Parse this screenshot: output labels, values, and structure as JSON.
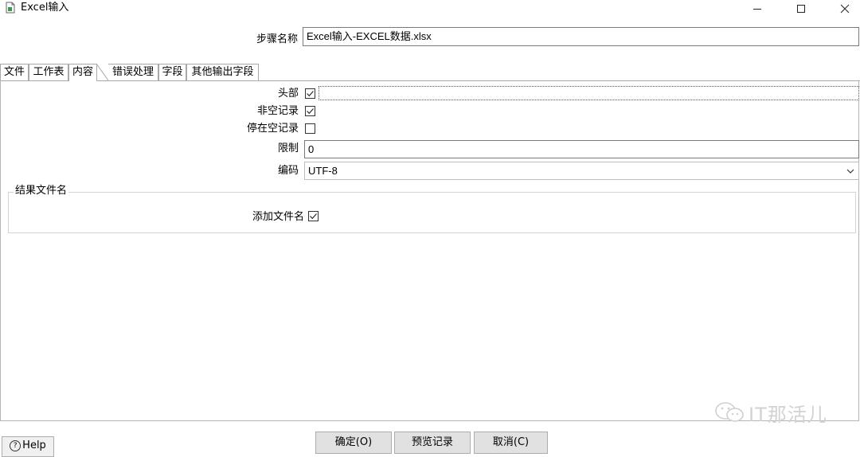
{
  "window": {
    "title": "Excel输入",
    "controls": {
      "minimize": "minimize-icon",
      "maximize": "maximize-icon",
      "close": "close-icon"
    }
  },
  "step": {
    "label": "步骤名称",
    "value": "Excel输入-EXCEL数据.xlsx"
  },
  "tabs": [
    {
      "label": "文件",
      "active": false
    },
    {
      "label": "工作表",
      "active": false
    },
    {
      "label": "内容",
      "active": true
    },
    {
      "label": "错误处理",
      "active": false
    },
    {
      "label": "字段",
      "active": false
    },
    {
      "label": "其他输出字段",
      "active": false
    }
  ],
  "content": {
    "header": {
      "label": "头部",
      "checked": true
    },
    "non_empty": {
      "label": "非空记录",
      "checked": true
    },
    "stop_on_empty": {
      "label": "停在空记录",
      "checked": false
    },
    "limit": {
      "label": "限制",
      "value": "0"
    },
    "encoding": {
      "label": "编码",
      "value": "UTF-8"
    }
  },
  "result_group": {
    "title": "结果文件名",
    "add_filename": {
      "label": "添加文件名",
      "checked": true
    }
  },
  "buttons": {
    "help": "Help",
    "ok": "确定(O)",
    "preview": "预览记录",
    "cancel": "取消(C)"
  },
  "watermark": "IT那活儿",
  "colors": {
    "border": "#7a7a7a",
    "button_bg": "#e1e1e1",
    "watermark": "#d2d2d2"
  }
}
